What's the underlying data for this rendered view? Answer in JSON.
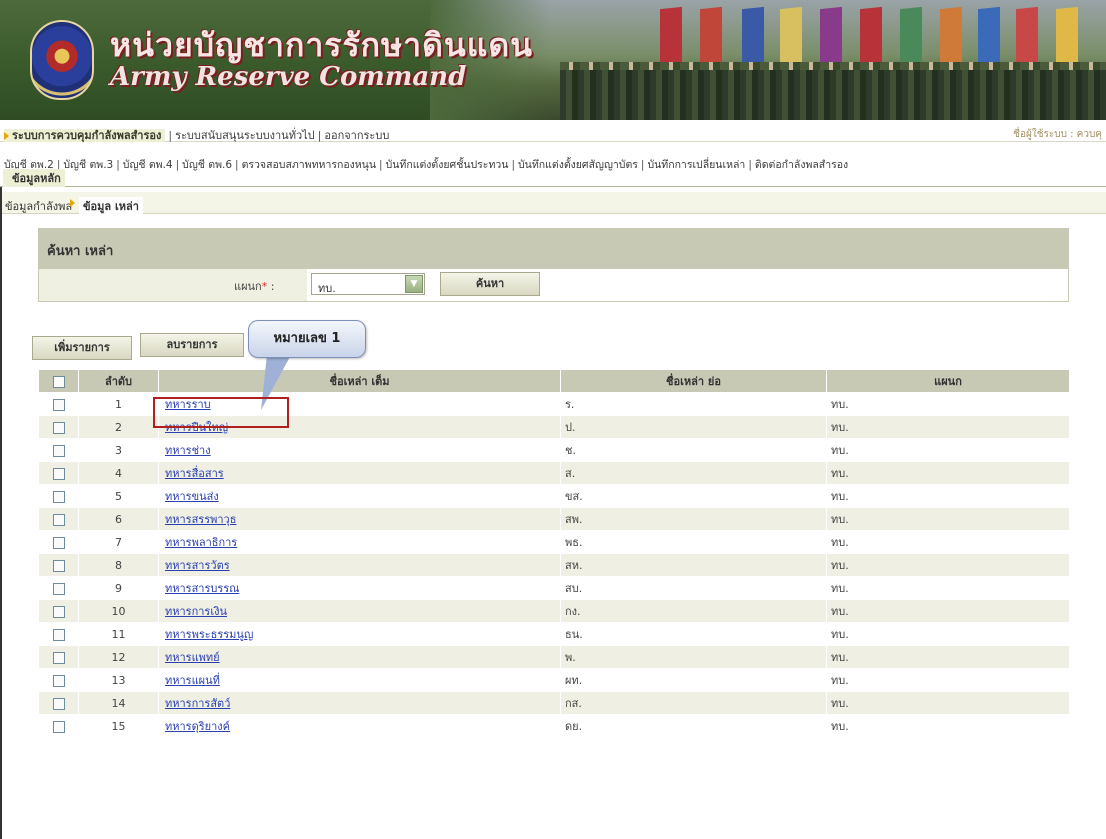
{
  "header": {
    "title_th": "หน่วยบัญชาการรักษาดินแดน",
    "title_en": "Army Reserve Command"
  },
  "topmenu": {
    "items": [
      "ระบบการควบคุมกำลังพลสำรอง",
      "ระบบสนับสนุนระบบงานทั่วไป",
      "ออกจากระบบ"
    ],
    "user_label": "ชื่อผู้ใช้ระบบ : ควบคุ"
  },
  "submenu": {
    "items": [
      "บัญชี ตพ.2",
      "บัญชี ตพ.3",
      "บัญชี ตพ.4",
      "บัญชี ตพ.6",
      "ตรวจสอบสภาพทหารกองหนุน",
      "บันทึกแต่งตั้งยศชั้นประทวน",
      "บันทึกแต่งตั้งยศสัญญาบัตร",
      "บันทึกการเปลี่ยนเหล่า",
      "ติดต่อกำลังพลสำรอง"
    ],
    "active": "ข้อมูลหลัก"
  },
  "breadcrumb": {
    "parent": "ข้อมูลกำลังพล",
    "current": "ข้อมูล เหล่า"
  },
  "search": {
    "title": "ค้นหา เหล่า",
    "label": "แผนก",
    "required_mark": "*",
    "colon": " :",
    "select_value": "ทบ.",
    "button": "ค้นหา"
  },
  "actions": {
    "add": "เพิ่มรายการ",
    "delete": "ลบรายการ"
  },
  "callout": "หมายเลข 1",
  "table": {
    "headers": {
      "no": "ลำดับ",
      "name": "ชื่อเหล่า เต็ม",
      "short": "ชื่อเหล่า ย่อ",
      "dept": "แผนก"
    },
    "rows": [
      {
        "no": "1",
        "name": "ทหารราบ",
        "short": "ร.",
        "dept": "ทบ."
      },
      {
        "no": "2",
        "name": "ทหารปืนใหญ่",
        "short": "ป.",
        "dept": "ทบ."
      },
      {
        "no": "3",
        "name": "ทหารช่าง",
        "short": "ช.",
        "dept": "ทบ."
      },
      {
        "no": "4",
        "name": "ทหารสื่อสาร",
        "short": "ส.",
        "dept": "ทบ."
      },
      {
        "no": "5",
        "name": "ทหารขนส่ง",
        "short": "ขส.",
        "dept": "ทบ."
      },
      {
        "no": "6",
        "name": "ทหารสรรพาวุธ",
        "short": "สพ.",
        "dept": "ทบ."
      },
      {
        "no": "7",
        "name": "ทหารพลาธิการ",
        "short": "พธ.",
        "dept": "ทบ."
      },
      {
        "no": "8",
        "name": "ทหารสารวัตร",
        "short": "สห.",
        "dept": "ทบ."
      },
      {
        "no": "9",
        "name": "ทหารสารบรรณ",
        "short": "สบ.",
        "dept": "ทบ."
      },
      {
        "no": "10",
        "name": "ทหารการเงิน",
        "short": "กง.",
        "dept": "ทบ."
      },
      {
        "no": "11",
        "name": "ทหารพระธรรมนูญ",
        "short": "ธน.",
        "dept": "ทบ."
      },
      {
        "no": "12",
        "name": "ทหารแพทย์",
        "short": "พ.",
        "dept": "ทบ."
      },
      {
        "no": "13",
        "name": "ทหารแผนที่",
        "short": "ผท.",
        "dept": "ทบ."
      },
      {
        "no": "14",
        "name": "ทหารการสัตว์",
        "short": "กส.",
        "dept": "ทบ."
      },
      {
        "no": "15",
        "name": "ทหารดุริยางค์",
        "short": "ดย.",
        "dept": "ทบ."
      }
    ]
  },
  "colors": {
    "header_bar": "#c8c9b5",
    "row_alt": "#efefe3",
    "link": "#2a3fb0",
    "menu_arrow": "#e8a400",
    "highlight_box": "#b02020"
  },
  "icons": [
    "emblem-logo",
    "dropdown-arrow-icon",
    "checkbox-icon",
    "menu-arrow-icon"
  ]
}
